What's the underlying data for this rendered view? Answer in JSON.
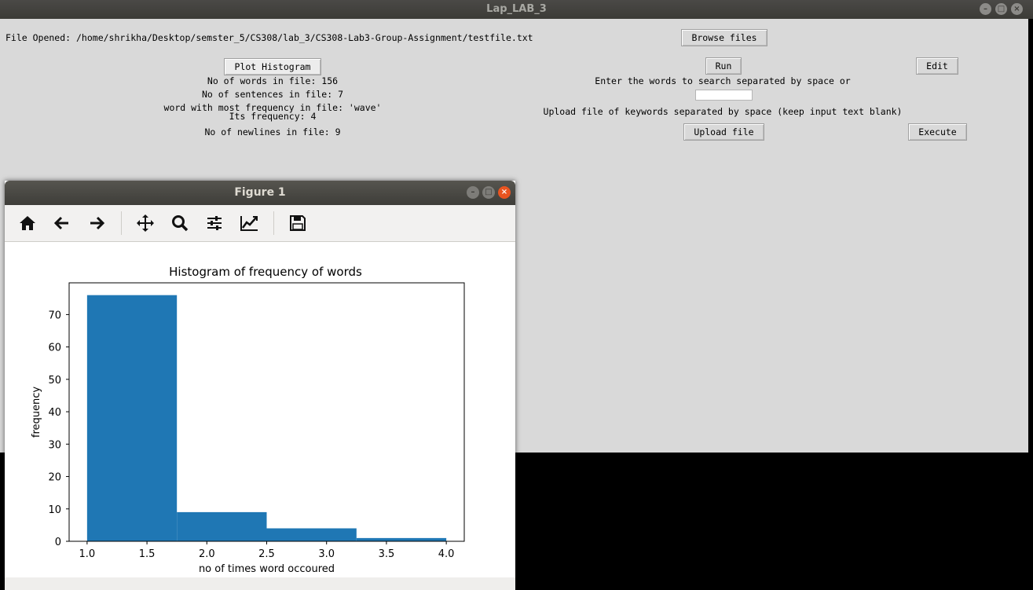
{
  "main": {
    "title": "Lap_LAB_3",
    "file_opened": "File Opened: /home/shrikha/Desktop/semster_5/CS308/lab_3/CS308-Lab3-Group-Assignment/testfile.txt",
    "buttons": {
      "browse": "Browse files",
      "plot": "Plot Histogram",
      "run": "Run",
      "edit": "Edit",
      "upload": "Upload file",
      "execute": "Execute"
    },
    "stats": {
      "words": "No of words in file: 156",
      "sentences": "No of sentences in file: 7",
      "most_frequent": "word with most frequency in file: 'wave'",
      "frequency": "Its frequency: 4",
      "newlines": "No of newlines in file: 9"
    },
    "search_prompt": "Enter the words to search separated by space or",
    "search_value": "",
    "upload_prompt": "Upload file of keywords separated by space (keep input text blank)"
  },
  "figure": {
    "title": "Figure 1",
    "toolbar": [
      "home-icon",
      "back-icon",
      "forward-icon",
      "pan-icon",
      "zoom-icon",
      "configure-icon",
      "edit-axes-icon",
      "save-icon"
    ]
  },
  "chart_data": {
    "type": "bar",
    "title": "Histogram of frequency of words",
    "xlabel": "no of times word occoured",
    "ylabel": "frequency",
    "bins": [
      [
        1.0,
        1.75
      ],
      [
        1.75,
        2.5
      ],
      [
        2.5,
        3.25
      ],
      [
        3.25,
        4.0
      ]
    ],
    "values": [
      76,
      9,
      4,
      1
    ],
    "xlim": [
      0.85,
      4.15
    ],
    "ylim": [
      0,
      79.8
    ],
    "xticks": [
      "1.0",
      "1.5",
      "2.0",
      "2.5",
      "3.0",
      "3.5",
      "4.0"
    ],
    "xtick_values": [
      1.0,
      1.5,
      2.0,
      2.5,
      3.0,
      3.5,
      4.0
    ],
    "yticks": [
      "0",
      "10",
      "20",
      "30",
      "40",
      "50",
      "60",
      "70"
    ],
    "ytick_values": [
      0,
      10,
      20,
      30,
      40,
      50,
      60,
      70
    ],
    "bar_color": "#1f77b4",
    "grid": false
  }
}
